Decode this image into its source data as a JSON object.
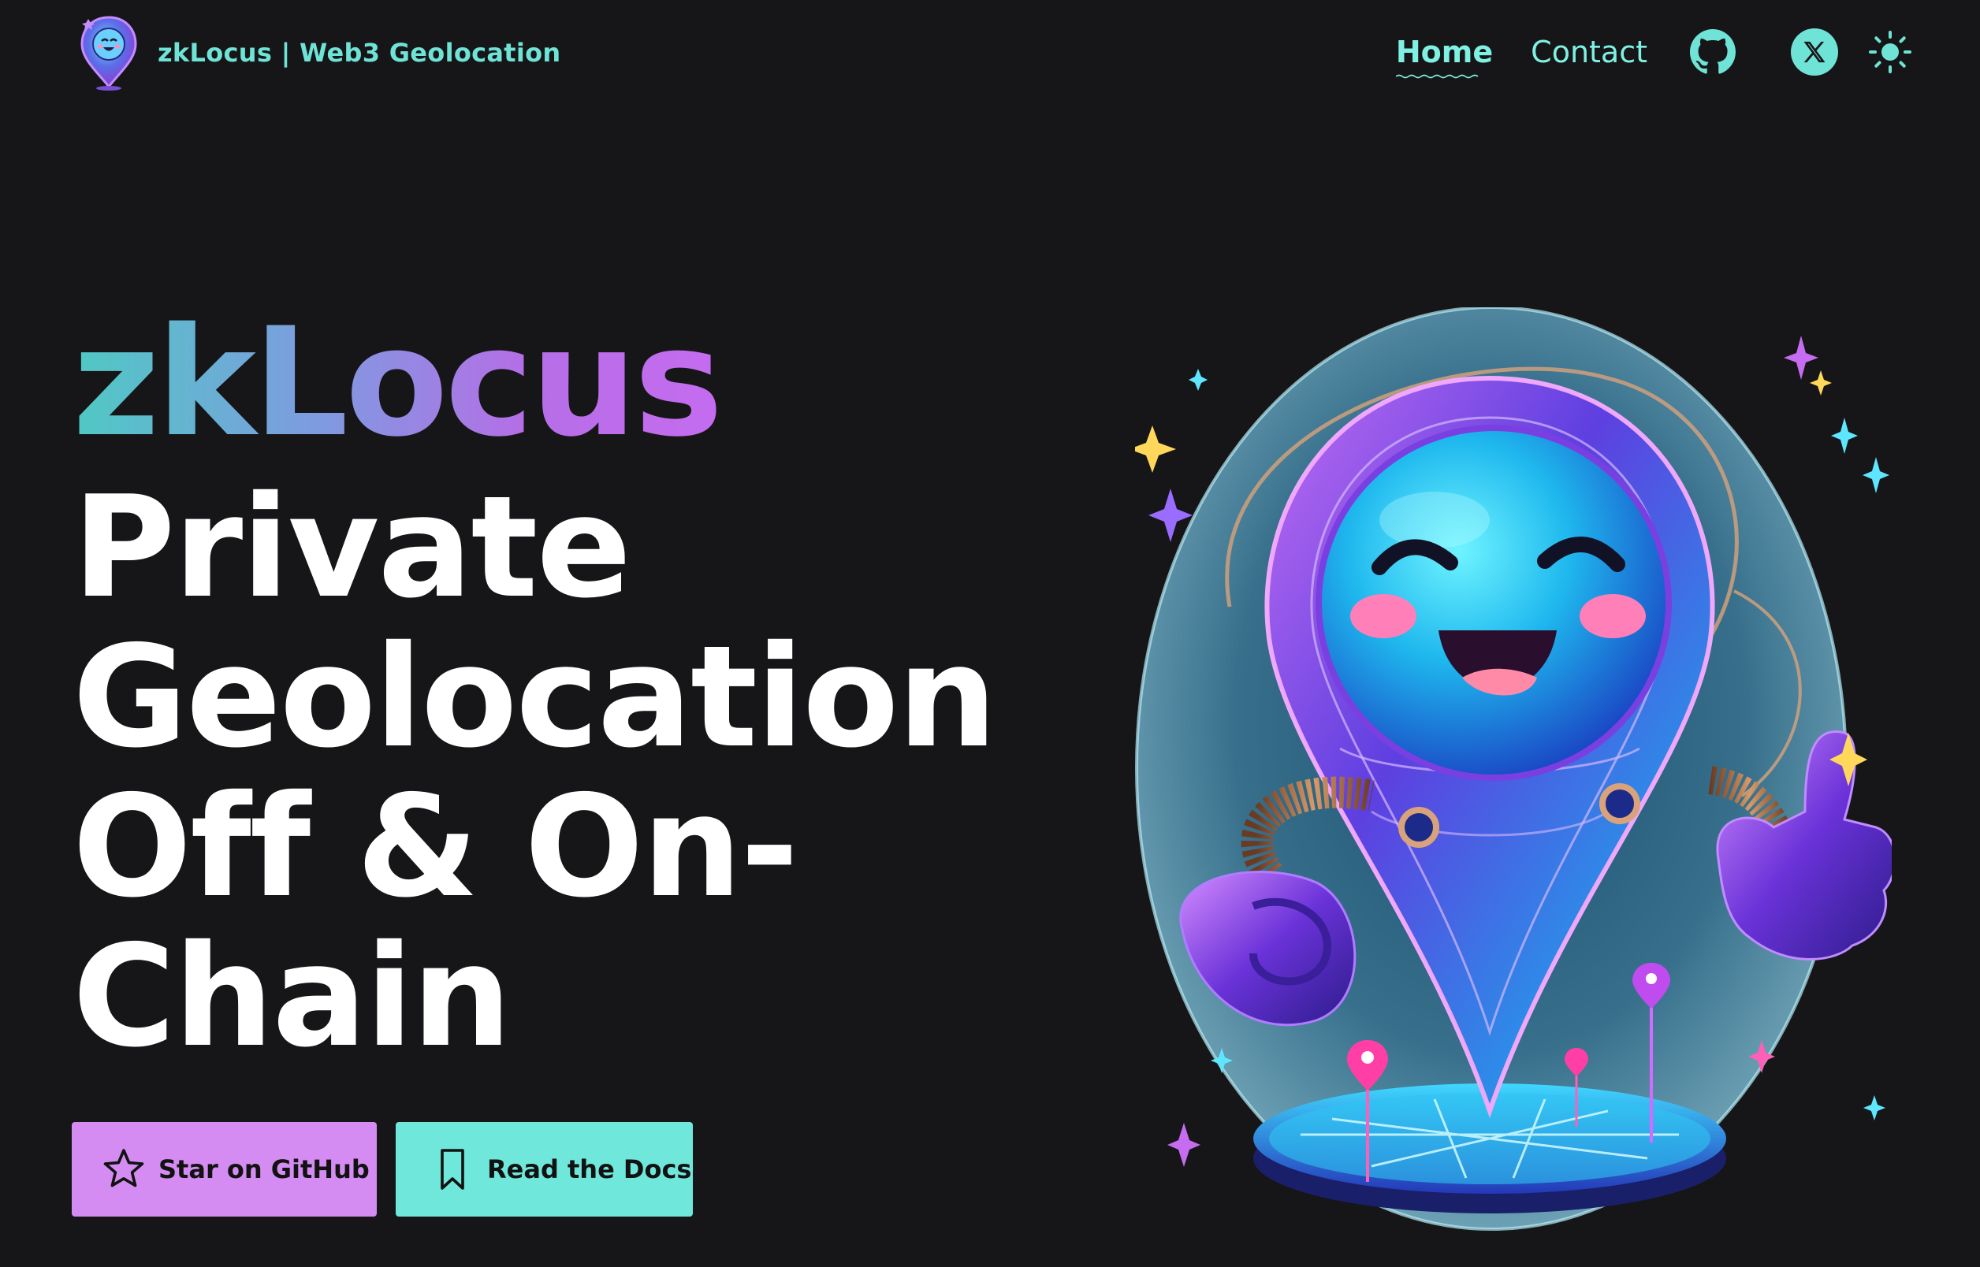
{
  "header": {
    "logo_icon": "map-pin-mascot-icon",
    "title": "zkLocus | Web3 Geolocation",
    "nav": {
      "home": "Home",
      "contact": "Contact"
    },
    "icons": {
      "github": "github-icon",
      "x": "x-twitter-icon",
      "theme": "sun-icon"
    }
  },
  "hero": {
    "brand": "zkLocus",
    "heading_lines": [
      "Private",
      "Geolocation",
      "Off & On-",
      "Chain"
    ],
    "buttons": {
      "star": "Star on GitHub",
      "docs": "Read the Docs"
    },
    "illustration": "map-pin-mascot-thumbs-up"
  },
  "colors": {
    "background": "#161618",
    "accent_teal": "#6fe3d6",
    "accent_purple": "#d48cf2",
    "gradient": [
      "#4fc9c4",
      "#7e9be0",
      "#b56ee6",
      "#c56cf0"
    ]
  }
}
